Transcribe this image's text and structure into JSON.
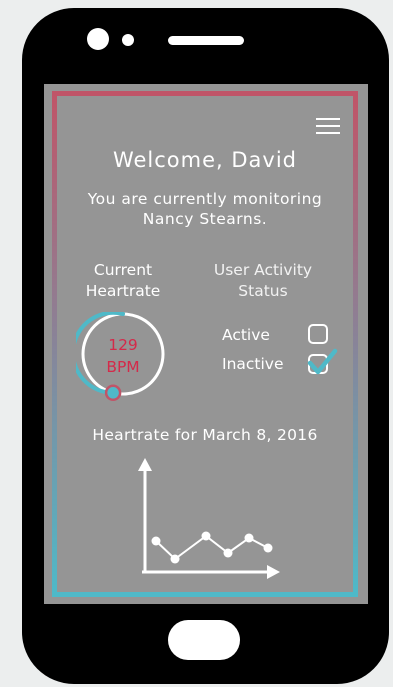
{
  "header": {
    "welcome": "Welcome, David",
    "monitoring_line1": "You are currently monitoring",
    "monitoring_line2": "Nancy Stearns."
  },
  "heartrate": {
    "label_line1": "Current",
    "label_line2": "Heartrate",
    "value": "129",
    "unit": "BPM",
    "gauge_fraction": 0.78
  },
  "activity": {
    "label_line1": "User Activity",
    "label_line2": "Status",
    "options": [
      {
        "label": "Active",
        "checked": false
      },
      {
        "label": "Inactive",
        "checked": true
      }
    ]
  },
  "graph": {
    "title": "Heartrate for March 8, 2016"
  },
  "colors": {
    "accent_teal": "#4fb9c8",
    "accent_red": "#c05568",
    "bpm_text": "#d42a4a",
    "screen_bg": "#959595"
  },
  "icons": [
    "hamburger-menu-icon",
    "checkmark-icon"
  ]
}
